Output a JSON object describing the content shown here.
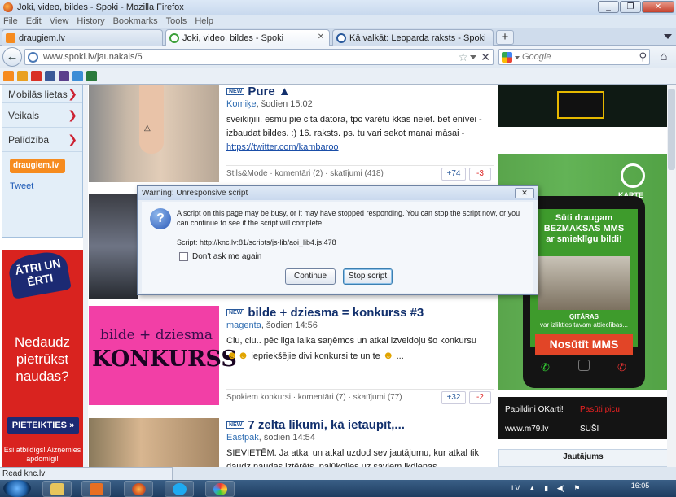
{
  "window": {
    "title": "Joki, video, bildes - Spoki - Mozilla Firefox"
  },
  "menu": [
    "File",
    "Edit",
    "View",
    "History",
    "Bookmarks",
    "Tools",
    "Help"
  ],
  "tabs": [
    {
      "label": "draugiem.lv",
      "active": false
    },
    {
      "label": "Joki, video, bildes - Spoki",
      "active": true
    },
    {
      "label": "Kā valkāt: Leoparda raksts - Spoki",
      "active": false
    }
  ],
  "nav": {
    "url": "www.spoki.lv/jaunakais/5",
    "search_placeholder": "Google"
  },
  "leftnav": {
    "items": [
      "Mobilās lietas",
      "Veikals",
      "Palīdzība"
    ],
    "draugiem_label": "draugiem.lv",
    "tweet_label": "Tweet"
  },
  "ad_left": {
    "badge": "ĀTRI UN ĒRTI",
    "headline": "Nedaudz pietrūkst naudas?",
    "cta": "PIETEIKTIES »",
    "small": "Esi atbildīgs! Aizņemies apdomīgi!"
  },
  "articles": [
    {
      "title": "Pure ▲",
      "new_badge": "NEW",
      "author": "Komiķe",
      "time": ", šodien 15:02",
      "text": "sveikiņiii. esmu pie cita datora, tpc varētu kkas neiet. bet enīvei - izbaudat bildes. :) 16. raksts. ps. tu vari sekot manai māsai -",
      "link": "https://twitter.com/kambaroo",
      "footer": "Stils&Mode · komentāri (2) · skatījumi (418)",
      "up": "+74",
      "down": "-3"
    },
    {
      "title": "bilde + dziesma = konkurss #3",
      "new_badge": "NEW",
      "author": "magenta",
      "time": ", šodien 14:56",
      "text": "Ciu, ciu.. pēc ilga laika saņēmos un atkal izveidoju šo konkursu",
      "text2": "iepriekšējie divi konkursi te un te",
      "text3": "...",
      "thumb_line1": "bilde + dziesma",
      "thumb_line2": "KONKURSS",
      "footer": "Spokiem konkursi · komentāri (7) · skatījumi (77)",
      "up": "+32",
      "down": "-2"
    },
    {
      "title": "7 zelta likumi, kā ietaupīt,...",
      "new_badge": "NEW",
      "author": "Eastpak",
      "time": ", šodien 14:54",
      "text": "SIEVIETĒM. Ja atkal un atkal uzdod sev jautājumu, kur atkal tik daudz naudas iztērēts, palūkojies uz saviem ikdienas"
    }
  ],
  "sidebar": {
    "okarte_word": "KARTE",
    "phone_lines": [
      "Sūti draugam",
      "BEZMAKSAS MMS",
      "ar smieklīgu bildi!"
    ],
    "phone_caption_1": "ĢITĀRAS",
    "phone_caption_2": "var izlikties tavam attieclības...",
    "phone_button": "Nosūtīt MMS",
    "links": [
      {
        "label": "Papildini OKarti!",
        "red": false
      },
      {
        "label": "Pasūti picu",
        "red": true
      },
      {
        "label": "www.m79.lv",
        "red": false
      },
      {
        "label": "SUŠI",
        "red": false
      }
    ],
    "question_title": "Jautājums"
  },
  "dialog": {
    "title": "Warning: Unresponsive script",
    "message": "A script on this page may be busy, or it may have stopped responding. You can stop the script now, or you can continue to see if the script will complete.",
    "script": "Script: http://knc.lv:81/scripts/js-lib/aoi_lib4.js:478",
    "checkbox_label": "Don't ask me again",
    "continue_label": "Continue",
    "stop_label": "Stop script"
  },
  "status": {
    "text": "Read knc.lv"
  },
  "taskbar": {
    "language": "LV",
    "time": "16:05"
  }
}
